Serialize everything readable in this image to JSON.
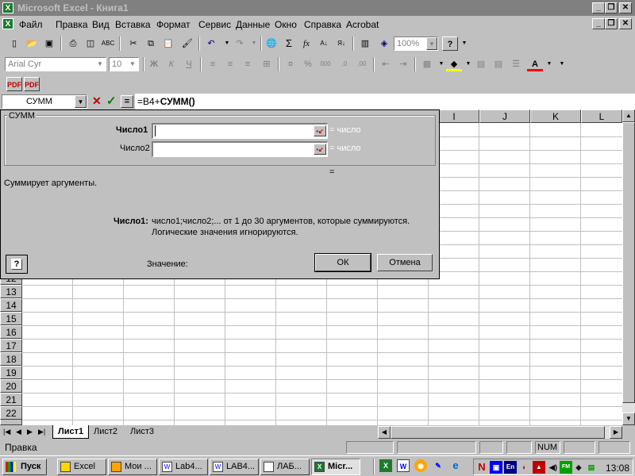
{
  "window": {
    "title": "Microsoft Excel - Книга1",
    "app_icon": "excel-icon"
  },
  "title_buttons": {
    "minimize": "_",
    "restore": "❐",
    "close": "✕"
  },
  "menu": {
    "items": [
      "Файл",
      "Правка",
      "Вид",
      "Вставка",
      "Формат",
      "Сервис",
      "Данные",
      "Окно",
      "Справка",
      "Acrobat"
    ],
    "doc_buttons": {
      "minimize": "_",
      "restore": "❐",
      "close": "✕"
    }
  },
  "toolbar": {
    "zoom": "100%",
    "icons": [
      "new-icon",
      "open-icon",
      "save-icon",
      "print-icon",
      "preview-icon",
      "spelling-icon",
      "cut-icon",
      "copy-icon",
      "paste-icon",
      "format-painter-icon",
      "undo-icon",
      "redo-icon",
      "hyperlink-icon",
      "autosum-icon",
      "function-icon",
      "sort-asc-icon",
      "sort-desc-icon",
      "chart-wizard-icon",
      "map-icon",
      "help-icon"
    ]
  },
  "format_toolbar": {
    "font": "Arial Cyr",
    "size": "10",
    "bold": "Ж",
    "italic": "К",
    "underline": "Ч",
    "percent": "%",
    "thousands": "000",
    "font_color": "A"
  },
  "formula_bar": {
    "name_box": "СУММ",
    "cancel": "✕",
    "enter": "✓",
    "equals": "=",
    "formula_prefix": "=B4+",
    "formula_func": "СУММ()"
  },
  "grid": {
    "columns": [
      "I",
      "J",
      "K",
      "L"
    ],
    "rows": [
      "12",
      "13",
      "14",
      "15",
      "16",
      "17",
      "18",
      "19",
      "20",
      "21",
      "22"
    ]
  },
  "dialog": {
    "group_title": "СУММ",
    "arg1_label": "Число1",
    "arg2_label": "Число2",
    "arg_result": "= число",
    "result_equals": "=",
    "description": "Суммирует аргументы.",
    "help_arg_label": "Число1:",
    "help_line1": "число1;число2;... от 1 до 30 аргументов, которые суммируются.",
    "help_line2": "Логические значения игнорируются.",
    "value_label": "Значение:",
    "ok": "ОК",
    "cancel": "Отмена",
    "help_icon": "?"
  },
  "sheet_tabs": [
    "Лист1",
    "Лист2",
    "Лист3"
  ],
  "status": {
    "text": "Правка",
    "num": "NUM"
  },
  "taskbar": {
    "start": "Пуск",
    "tasks": [
      "Excel",
      "Мои ...",
      "Lab4...",
      "LAB4...",
      "ЛАБ...",
      "Micr..."
    ],
    "clock": "13:08",
    "tray": [
      "N",
      "En"
    ]
  },
  "colors": {
    "selection_blue": "#000080",
    "white": "#ffffff",
    "face": "#c0c0c0"
  }
}
